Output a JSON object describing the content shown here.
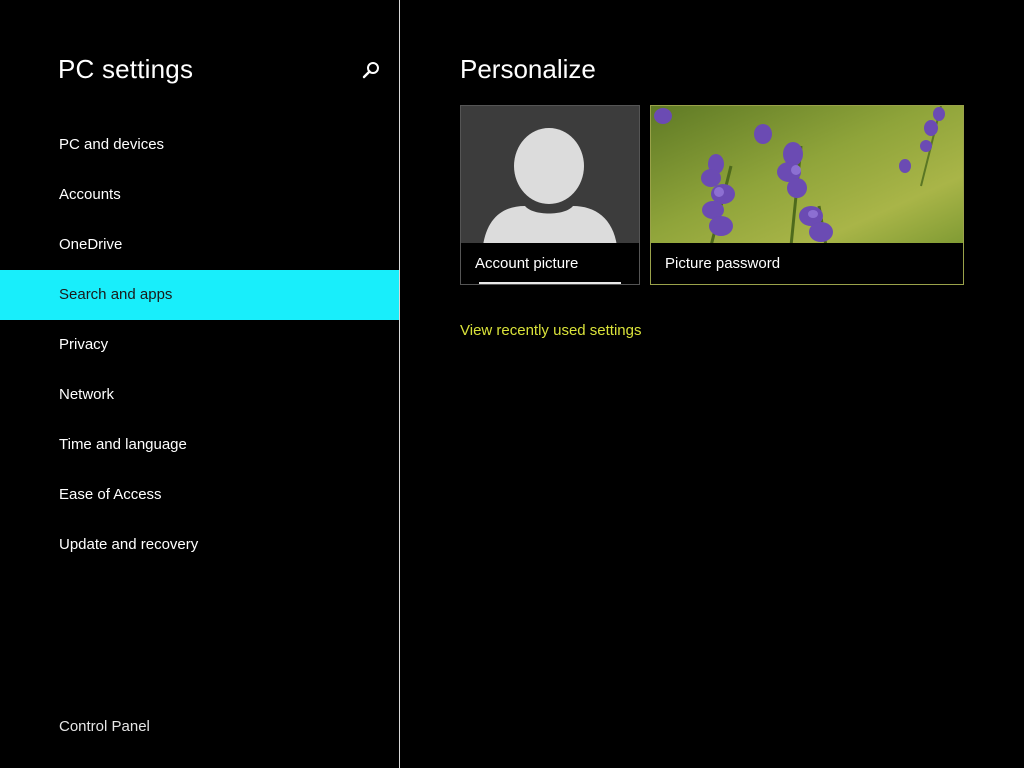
{
  "sidebar": {
    "title": "PC settings",
    "search_icon": "search-icon",
    "items": [
      {
        "label": "PC and devices",
        "selected": false
      },
      {
        "label": "Accounts",
        "selected": false
      },
      {
        "label": "OneDrive",
        "selected": false
      },
      {
        "label": "Search and apps",
        "selected": true
      },
      {
        "label": "Privacy",
        "selected": false
      },
      {
        "label": "Network",
        "selected": false
      },
      {
        "label": "Time and language",
        "selected": false
      },
      {
        "label": "Ease of Access",
        "selected": false
      },
      {
        "label": "Update and recovery",
        "selected": false
      }
    ],
    "footer_link": "Control Panel"
  },
  "main": {
    "title": "Personalize",
    "tiles": [
      {
        "label": "Account picture",
        "icon": "user-silhouette-icon"
      },
      {
        "label": "Picture password",
        "image": "lavender-flowers-image"
      }
    ],
    "recent_link": "View recently used settings"
  },
  "colors": {
    "background": "#000000",
    "accent_selected": "#18eefb",
    "link": "#d9e23a",
    "divider": "#d9d9d9"
  }
}
